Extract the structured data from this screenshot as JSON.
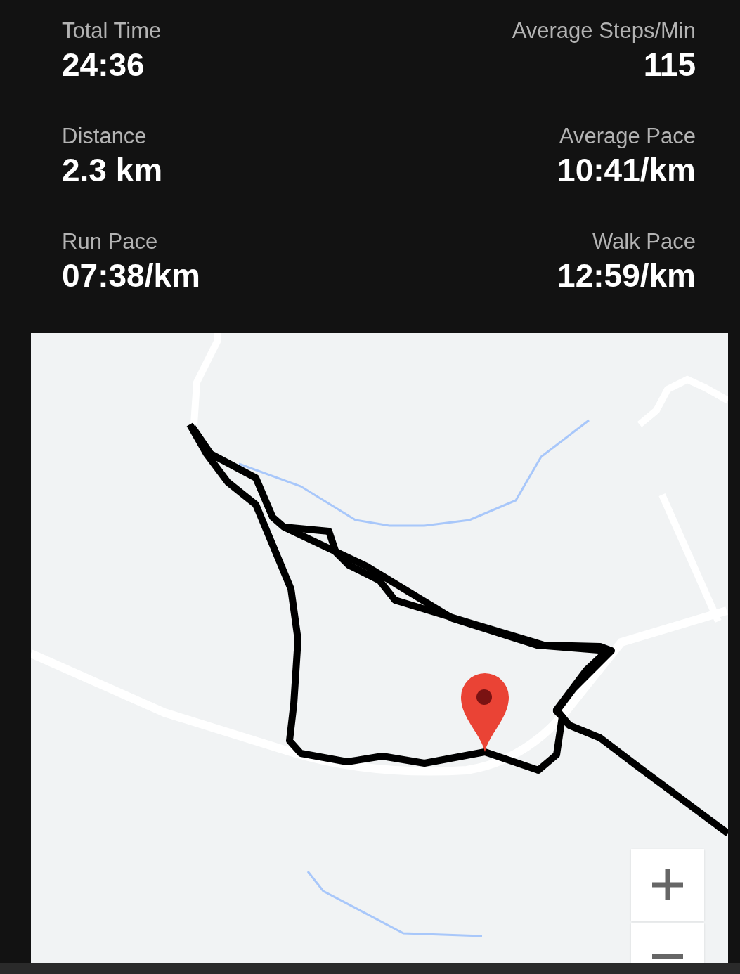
{
  "stats": [
    {
      "label": "Total Time",
      "value": "24:36"
    },
    {
      "label": "Average Steps/Min",
      "value": "115"
    },
    {
      "label": "Distance",
      "value": "2.3 km"
    },
    {
      "label": "Average Pace",
      "value": "10:41/km"
    },
    {
      "label": "Run Pace",
      "value": "07:38/km"
    },
    {
      "label": "Walk Pace",
      "value": "12:59/km"
    }
  ]
}
